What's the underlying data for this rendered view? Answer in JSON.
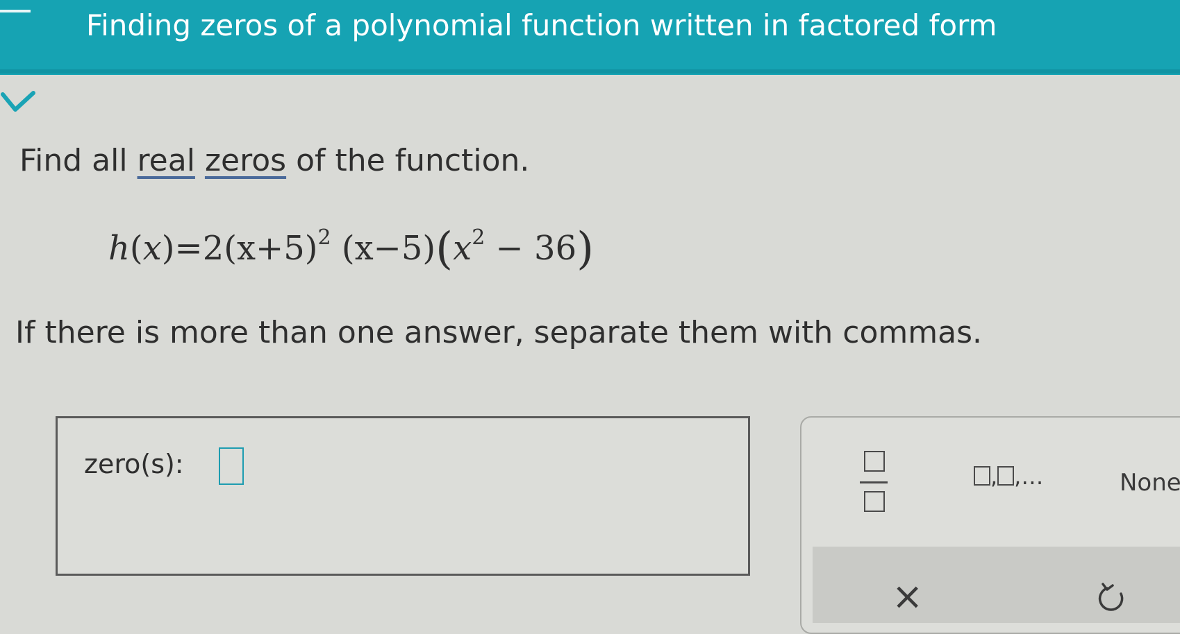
{
  "header": {
    "title": "Finding zeros of a polynomial function written in factored form"
  },
  "problem": {
    "prompt_before": "Find all ",
    "link_real": "real",
    "link_zeros": "zeros",
    "prompt_after": " of the function.",
    "equation": {
      "fn": "h",
      "var": "x",
      "eq": "=2",
      "factor1": "(x+5)",
      "exp1": "2",
      "factor2": "(x−5)",
      "factor3_open": "(",
      "factor3_var": "x",
      "exp3": "2",
      "factor3_rest": " − 36",
      "factor3_close": ")"
    },
    "instruction": "If there is more than one answer, separate them with commas."
  },
  "answer": {
    "label": "zero(s):",
    "value": ""
  },
  "keypad": {
    "list_label": ",…",
    "none_label": "None",
    "clear_label": "×"
  },
  "colors": {
    "header": "#16a3b3",
    "accent": "#1e9cb0"
  },
  "icons": [
    "chevron-down-icon",
    "fraction-icon",
    "clear-icon",
    "undo-icon"
  ]
}
